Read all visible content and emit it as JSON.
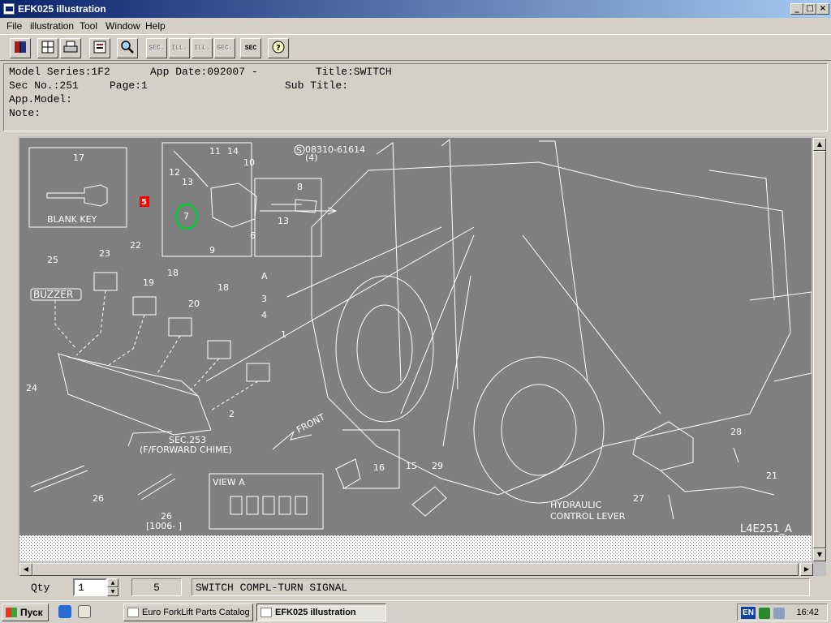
{
  "window": {
    "title": "EFK025 illustration",
    "buttons": [
      "_",
      "□",
      "×"
    ]
  },
  "menu": [
    "File",
    "illustration",
    "Tool",
    "Window",
    "Help"
  ],
  "toolbar": [
    {
      "id": "book",
      "icon": "book-icon",
      "label": ""
    },
    {
      "id": "grid",
      "icon": "grid-icon",
      "label": ""
    },
    {
      "id": "print",
      "icon": "printer-icon",
      "label": ""
    },
    {
      "id": "catalog",
      "icon": "catalog-icon",
      "label": ""
    },
    {
      "id": "search",
      "icon": "magnifier-icon",
      "label": ""
    },
    {
      "id": "sec-prev",
      "icon": "sec-prev-icon",
      "label": "SEC."
    },
    {
      "id": "ill-prev",
      "icon": "ill-prev-icon",
      "label": "ILL."
    },
    {
      "id": "ill-next",
      "icon": "ill-next-icon",
      "label": "ILL."
    },
    {
      "id": "sec-next",
      "icon": "sec-next-icon",
      "label": "SEC."
    },
    {
      "id": "sec-jump",
      "icon": "sec-jump-icon",
      "label": "SEC"
    },
    {
      "id": "help",
      "icon": "help-icon",
      "label": "?"
    }
  ],
  "info": {
    "model_series": "Model Series:1F2",
    "app_date": "App Date:092007 -",
    "title": "Title:SWITCH",
    "sec_no": "Sec No.:251",
    "page": "Page:1",
    "sub_title": "Sub Title:",
    "app_model": "App.Model:",
    "note": "Note:"
  },
  "illustration": {
    "code": "L4E251_A",
    "selected_callout": "5",
    "labels": {
      "blank_key": "BLANK KEY",
      "buzzer": "BUZZER",
      "part_number": "08310-61614",
      "part_qty": "(4)",
      "sec_ref": "SEC.253",
      "sec_ref_desc": "(F/FORWARD CHIME)",
      "front": "FRONT",
      "view_a": "VIEW A",
      "hydraulic_1": "HYDRAULIC",
      "hydraulic_2": "CONTROL LEVER",
      "range_note": "[1006-    ]",
      "arrow_a": "A",
      "circle_s": "S"
    },
    "callouts": [
      {
        "n": "17"
      },
      {
        "n": "11"
      },
      {
        "n": "14"
      },
      {
        "n": "10"
      },
      {
        "n": "12"
      },
      {
        "n": "13"
      },
      {
        "n": "8"
      },
      {
        "n": "7"
      },
      {
        "n": "13"
      },
      {
        "n": "6"
      },
      {
        "n": "9"
      },
      {
        "n": "25"
      },
      {
        "n": "23"
      },
      {
        "n": "22"
      },
      {
        "n": "18"
      },
      {
        "n": "19"
      },
      {
        "n": "18"
      },
      {
        "n": "3"
      },
      {
        "n": "20"
      },
      {
        "n": "4"
      },
      {
        "n": "1"
      },
      {
        "n": "24"
      },
      {
        "n": "2"
      },
      {
        "n": "26"
      },
      {
        "n": "26"
      },
      {
        "n": "15"
      },
      {
        "n": "16"
      },
      {
        "n": "29"
      },
      {
        "n": "28"
      },
      {
        "n": "27"
      },
      {
        "n": "21"
      }
    ]
  },
  "status": {
    "qty_label": "Qty",
    "qty_value": "1",
    "item_no": "5",
    "description": "SWITCH COMPL-TURN SIGNAL"
  },
  "taskbar": {
    "start": "Пуск",
    "tasks": [
      "Euro ForkLift Parts Catalog",
      "EFK025 illustration"
    ],
    "lang": "EN",
    "clock": "16:42"
  },
  "colors": {
    "drawing_bg": "#7f7f7f",
    "line": "#ffffff",
    "highlight_green": "#00cc33",
    "selected_red": "#ff0000",
    "title_dark": "#0a246a"
  }
}
